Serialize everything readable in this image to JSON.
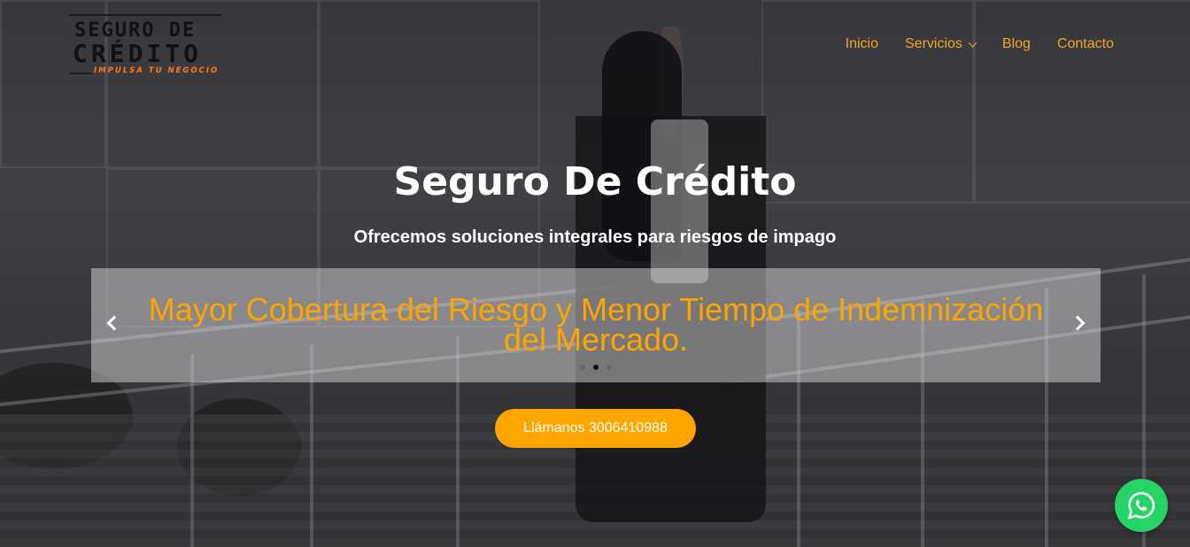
{
  "brand": {
    "logo_line1": "SEGURO DE",
    "logo_line2": "CRÉDITO",
    "logo_tagline": "IMPULSA TU NEGOCIO",
    "accent_color": "#ffa500",
    "nav_color": "#f5a623",
    "whatsapp_color": "#25d366"
  },
  "nav": {
    "items": [
      {
        "label": "Inicio"
      },
      {
        "label": "Servicios",
        "has_dropdown": true
      },
      {
        "label": "Blog"
      },
      {
        "label": "Contacto"
      }
    ]
  },
  "hero": {
    "title": "Seguro De Crédito",
    "subtitle": "Ofrecemos soluciones integrales para riesgos de impago",
    "slider": {
      "text": "Mayor Cobertura del Riesgo y Menor Tiempo de Indemnización del Mercado.",
      "dot_count": 3,
      "active_dot": 1
    },
    "cta_label": "Llámanos 3006410988"
  },
  "icons": {
    "whatsapp": "whatsapp-icon",
    "prev": "chevron-left-icon",
    "next": "chevron-right-icon",
    "dropdown": "chevron-down-icon"
  }
}
